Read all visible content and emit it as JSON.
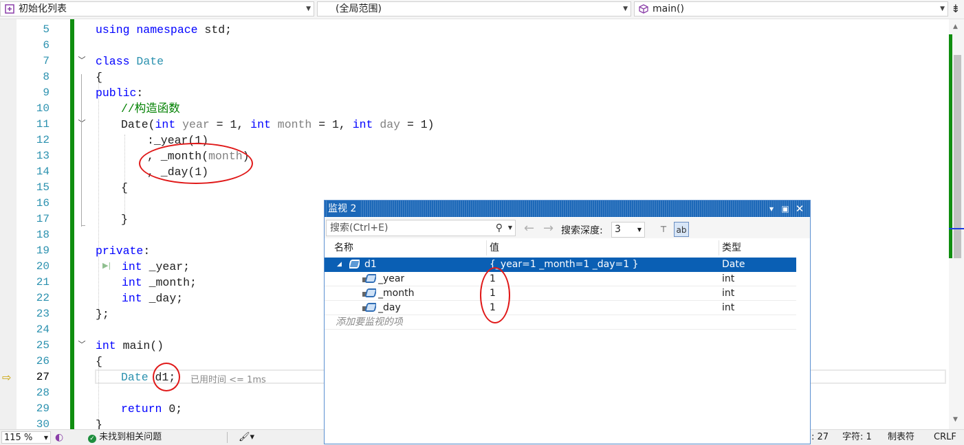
{
  "navbar": {
    "project": "初始化列表",
    "scope": "(全局范围)",
    "function": "main()"
  },
  "editor": {
    "lines": [
      {
        "n": "5"
      },
      {
        "n": "6"
      },
      {
        "n": "7"
      },
      {
        "n": "8"
      },
      {
        "n": "9"
      },
      {
        "n": "10"
      },
      {
        "n": "11"
      },
      {
        "n": "12"
      },
      {
        "n": "13"
      },
      {
        "n": "14"
      },
      {
        "n": "15"
      },
      {
        "n": "16"
      },
      {
        "n": "17"
      },
      {
        "n": "18"
      },
      {
        "n": "19"
      },
      {
        "n": "20"
      },
      {
        "n": "21"
      },
      {
        "n": "22"
      },
      {
        "n": "23"
      },
      {
        "n": "24"
      },
      {
        "n": "25"
      },
      {
        "n": "26"
      },
      {
        "n": "27"
      },
      {
        "n": "28"
      },
      {
        "n": "29"
      },
      {
        "n": "30"
      }
    ],
    "code": {
      "l5_kw": "using namespace",
      "l5_rest": " std;",
      "l7_kw": "class",
      "l7_ty": "Date",
      "l8": "{",
      "l9_kw": "public",
      "l9_rest": ":",
      "l10": "//构造函数",
      "l11_a": "Date(",
      "l11_int1": "int",
      "l11_p1": "year",
      "l11_b": " = 1, ",
      "l11_int2": "int",
      "l11_p2": "month",
      "l11_c": " = 1, ",
      "l11_int3": "int",
      "l11_p3": "day",
      "l11_d": " = 1)",
      "l12": ":_year(1)",
      "l13_a": ", _month(",
      "l13_p": "month",
      "l13_b": ")",
      "l14": ", _day(1)",
      "l15": "{",
      "l17": "}",
      "l19_kw": "private",
      "l19_rest": ":",
      "l20_int": "int",
      "l20_rest": " _year;",
      "l21_int": "int",
      "l21_rest": " _month;",
      "l22_int": "int",
      "l22_rest": " _day;",
      "l23": "};",
      "l25_int": "int",
      "l25_rest": " main()",
      "l26": "{",
      "l27_ty": "Date",
      "l27_rest": " d1;",
      "l29_kw": "return",
      "l29_rest": " 0;",
      "l30": "}"
    },
    "perf_tip": "已用时间 <= 1ms"
  },
  "watch": {
    "title": "监视 2",
    "search_placeholder": "搜索(Ctrl+E)",
    "depth_label": "搜索深度:",
    "depth_value": "3",
    "columns": {
      "name": "名称",
      "value": "值",
      "type": "类型"
    },
    "rows": [
      {
        "name": "d1",
        "value": "{_year=1 _month=1 _day=1 }",
        "type": "Date"
      },
      {
        "name": "_year",
        "value": "1",
        "type": "int"
      },
      {
        "name": "_month",
        "value": "1",
        "type": "int"
      },
      {
        "name": "_day",
        "value": "1",
        "type": "int"
      }
    ],
    "add_item": "添加要监视的项"
  },
  "status": {
    "zoom": "115 %",
    "issues": "未找到相关问题",
    "col": ": 27",
    "char": "字符: 1",
    "tabs": "制表符",
    "eol": "CRLF"
  },
  "colors": {
    "keyword": "#0000ff",
    "type": "#2b91af",
    "comment": "#008000",
    "change_bar": "#108e10",
    "selection": "#0a5fb4",
    "annotation": "#e01818"
  },
  "icons": [
    "class-icon",
    "cube-icon",
    "chevron-down-icon",
    "split-icon",
    "fold-icon",
    "search-icon",
    "arrow-left-icon",
    "arrow-right-icon",
    "pin-icon",
    "hex-icon",
    "object-icon",
    "lock-icon",
    "check-icon",
    "brush-icon",
    "exec-arrow-icon"
  ]
}
